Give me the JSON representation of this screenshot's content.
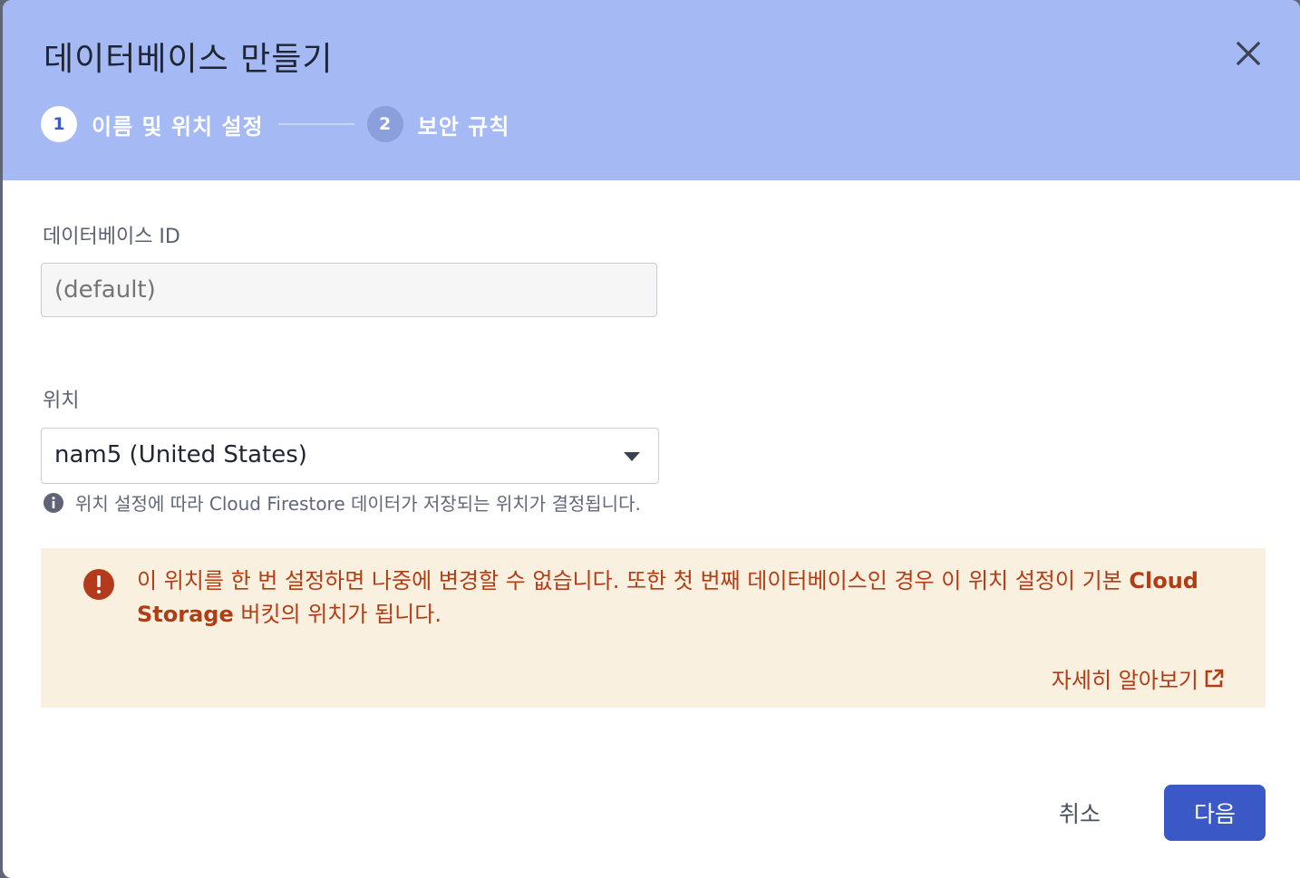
{
  "dialog": {
    "title": "데이터베이스 만들기",
    "close_icon": "close-icon"
  },
  "stepper": {
    "steps": [
      {
        "number": "1",
        "label": "이름 및 위치 설정",
        "state": "active"
      },
      {
        "number": "2",
        "label": "보안 규칙",
        "state": "inactive"
      }
    ]
  },
  "database_id": {
    "label": "데이터베이스 ID",
    "placeholder": "(default)",
    "value": ""
  },
  "location": {
    "label": "위치",
    "selected": "nam5 (United States)",
    "hint": "위치 설정에 따라 Cloud Firestore 데이터가 저장되는 위치가 결정됩니다.",
    "hint_icon": "info-icon"
  },
  "warning": {
    "icon": "error-icon",
    "text_part1": "이 위치를 한 번 설정하면 나중에 변경할 수 없습니다. 또한 첫 번째 데이터베이스인 경우 이 위치 설정이 기본 ",
    "text_bold": "Cloud Storage",
    "text_part2": " 버킷의 위치가 됩니다.",
    "learn_more": "자세히 알아보기",
    "learn_more_icon": "external-link-icon"
  },
  "actions": {
    "cancel": "취소",
    "next": "다음"
  },
  "colors": {
    "header_bg": "#a5b9f4",
    "primary": "#3a58c6",
    "warning_bg": "#faf0e0",
    "warning_text": "#b23d15"
  }
}
